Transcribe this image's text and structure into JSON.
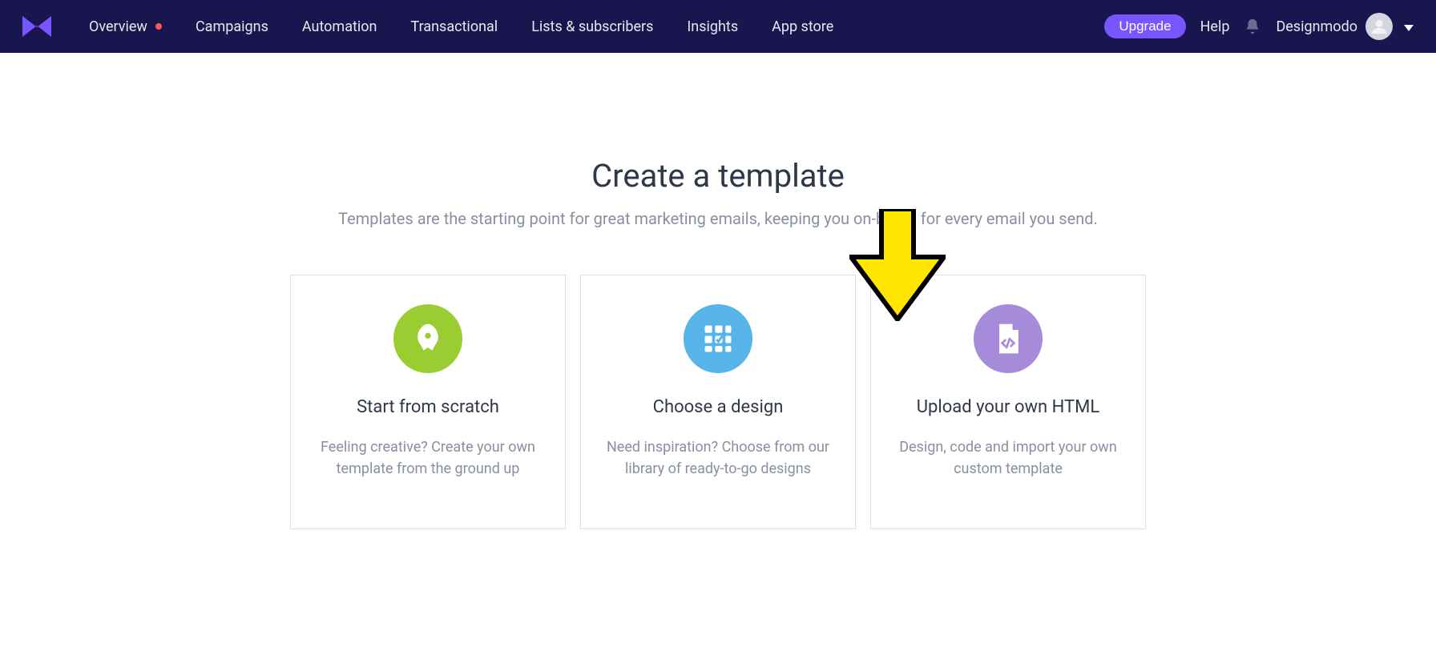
{
  "header": {
    "nav": [
      {
        "label": "Overview",
        "has_dot": true
      },
      {
        "label": "Campaigns"
      },
      {
        "label": "Automation"
      },
      {
        "label": "Transactional"
      },
      {
        "label": "Lists & subscribers"
      },
      {
        "label": "Insights"
      },
      {
        "label": "App store"
      }
    ],
    "upgrade": "Upgrade",
    "help": "Help",
    "account_name": "Designmodo"
  },
  "main": {
    "title": "Create a template",
    "subtitle": "Templates are the starting point for great marketing emails, keeping you on-brand for every email you send."
  },
  "cards": [
    {
      "title": "Start from scratch",
      "desc": "Feeling creative? Create your own template from the ground up",
      "icon": "rocket-icon",
      "icon_color": "green"
    },
    {
      "title": "Choose a design",
      "desc": "Need inspiration? Choose from our library of ready-to-go designs",
      "icon": "grid-icon",
      "icon_color": "blue"
    },
    {
      "title": "Upload your own HTML",
      "desc": "Design, code and import your own custom template",
      "icon": "code-file-icon",
      "icon_color": "purple"
    }
  ],
  "colors": {
    "header_bg": "#19154f",
    "accent": "#7856ff",
    "card_green": "#99cc2d",
    "card_blue": "#56b4e9",
    "card_purple": "#a78bdb",
    "text_primary": "#2f3849",
    "text_muted": "#8790a2",
    "arrow": "#ffe600"
  }
}
